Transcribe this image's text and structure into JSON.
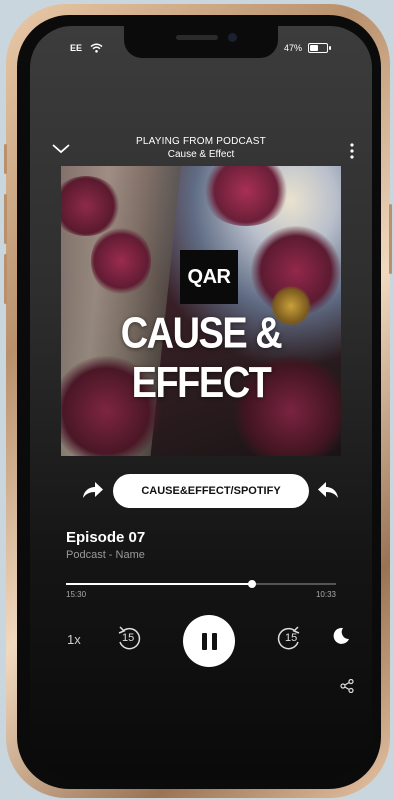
{
  "status_bar": {
    "carrier": "EE",
    "battery_percent": "47%",
    "battery_level": 0.47
  },
  "header": {
    "subtitle": "PLAYING FROM PODCAST",
    "title": "Cause & Effect"
  },
  "artwork": {
    "logo_text": "QAR",
    "title": "CAUSE & EFFECT"
  },
  "share": {
    "link_label": "CAUSE&EFFECT/SPOTIFY"
  },
  "episode": {
    "title": "Episode 07",
    "subtitle": "Podcast - Name"
  },
  "progress": {
    "current": "15:30",
    "total": "10:33",
    "fraction": 0.69
  },
  "controls": {
    "speed_label": "1x",
    "skip_back_label": "15",
    "skip_forward_label": "15"
  },
  "icons": {
    "chevron": "chevron-down-icon",
    "more": "more-vertical-icon",
    "back": "skip-back-15-icon",
    "forward": "skip-forward-15-icon",
    "pause": "pause-icon",
    "sleep": "moon-icon",
    "share": "share-icon"
  },
  "colors": {
    "accent": "#ffffff",
    "background": "#2e2e2e"
  }
}
